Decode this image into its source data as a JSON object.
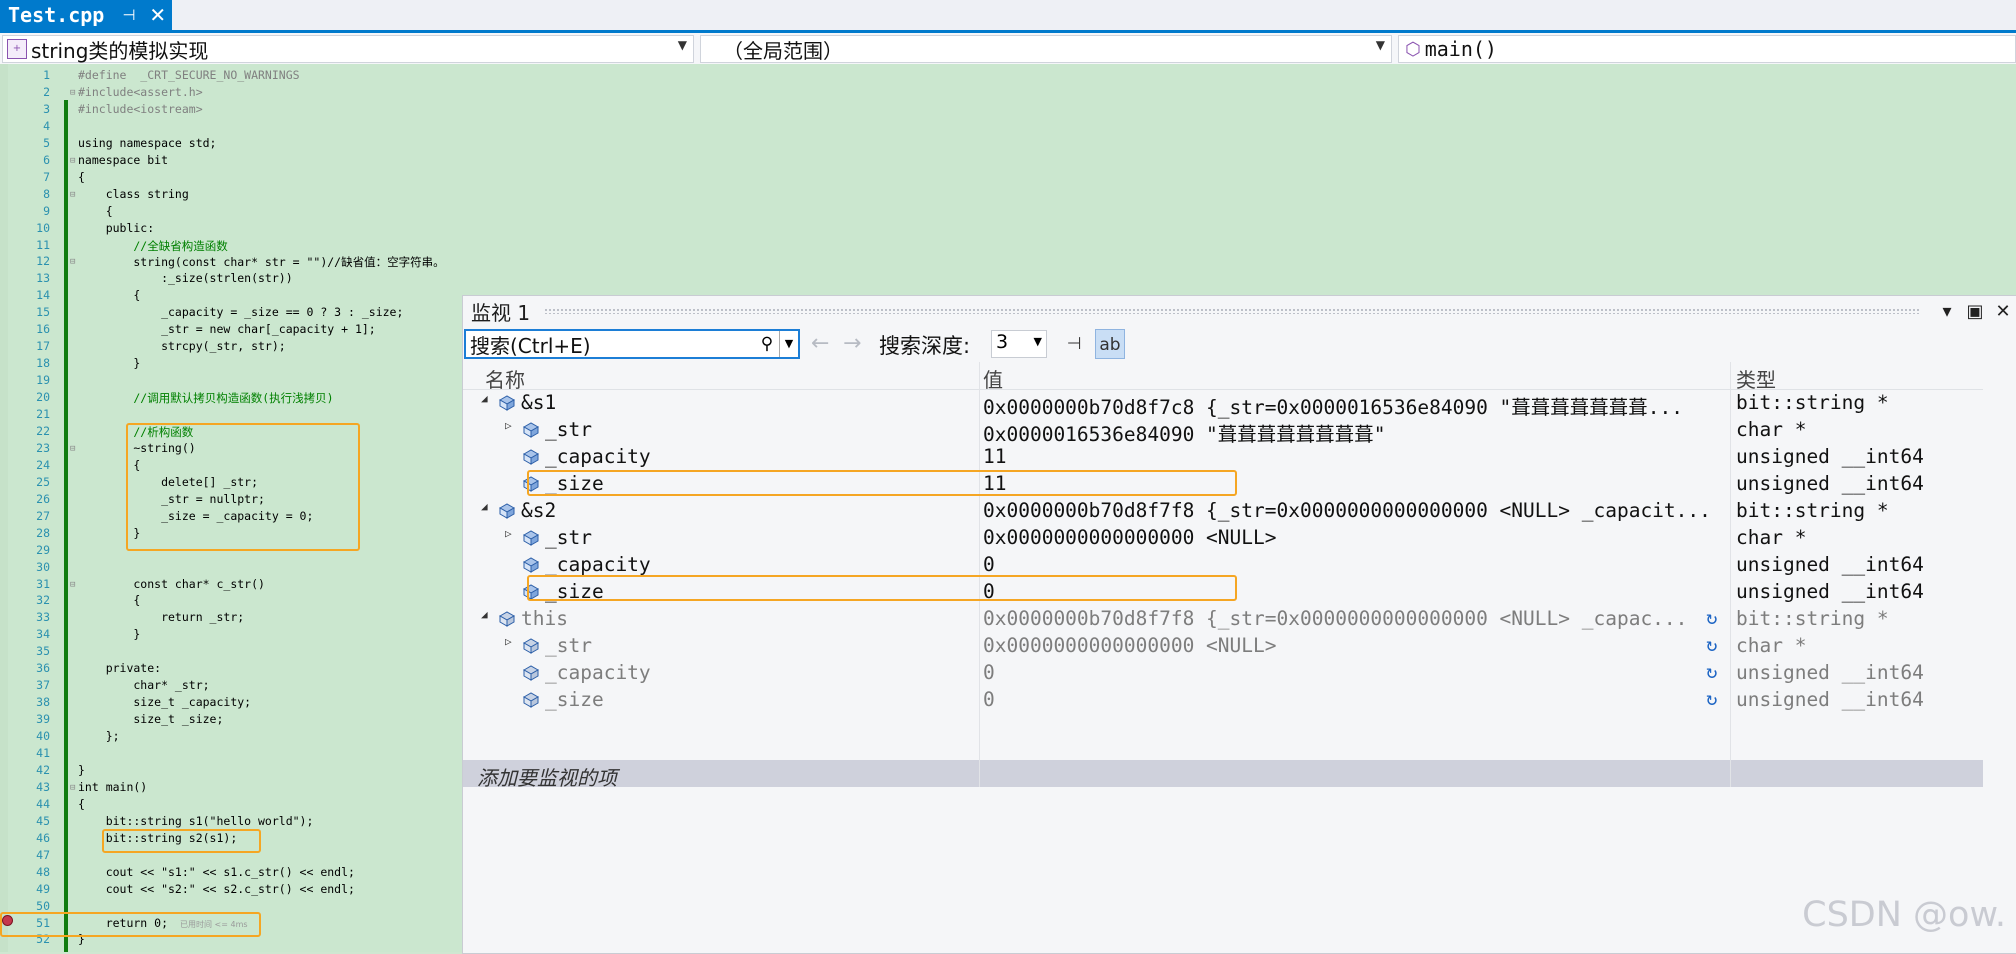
{
  "tab": {
    "title": "Test.cpp",
    "pin": "⊣",
    "close": "✕"
  },
  "nav": {
    "scope1": "string类的模拟实现",
    "scope2": "（全局范围）",
    "scope3": "main()"
  },
  "code": [
    {
      "n": "1",
      "t": "#define  _CRT_SECURE_NO_WARNINGS",
      "c": "pp"
    },
    {
      "n": "2",
      "t": "#include<assert.h>",
      "c": "pp"
    },
    {
      "n": "3",
      "t": "#include<iostream>",
      "c": "pp"
    },
    {
      "n": "4",
      "t": "",
      "c": ""
    },
    {
      "n": "5",
      "t": "using namespace std;",
      "c": ""
    },
    {
      "n": "6",
      "t": "namespace bit",
      "c": ""
    },
    {
      "n": "7",
      "t": "{",
      "c": ""
    },
    {
      "n": "8",
      "t": "    class string",
      "c": ""
    },
    {
      "n": "9",
      "t": "    {",
      "c": ""
    },
    {
      "n": "10",
      "t": "    public:",
      "c": ""
    },
    {
      "n": "11",
      "t": "        //全缺省构造函数",
      "c": "cm"
    },
    {
      "n": "12",
      "t": "        string(const char* str = \"\")//缺省值：空字符串。",
      "c": ""
    },
    {
      "n": "13",
      "t": "            :_size(strlen(str))",
      "c": ""
    },
    {
      "n": "14",
      "t": "        {",
      "c": ""
    },
    {
      "n": "15",
      "t": "            _capacity = _size == 0 ? 3 : _size;",
      "c": ""
    },
    {
      "n": "16",
      "t": "            _str = new char[_capacity + 1];",
      "c": ""
    },
    {
      "n": "17",
      "t": "            strcpy(_str, str);",
      "c": ""
    },
    {
      "n": "18",
      "t": "        }",
      "c": ""
    },
    {
      "n": "19",
      "t": "",
      "c": ""
    },
    {
      "n": "20",
      "t": "        //调用默认拷贝构造函数(执行浅拷贝)",
      "c": "cm"
    },
    {
      "n": "21",
      "t": "",
      "c": ""
    },
    {
      "n": "22",
      "t": "        //析构函数",
      "c": "cm"
    },
    {
      "n": "23",
      "t": "        ~string()",
      "c": ""
    },
    {
      "n": "24",
      "t": "        {",
      "c": ""
    },
    {
      "n": "25",
      "t": "            delete[] _str;",
      "c": ""
    },
    {
      "n": "26",
      "t": "            _str = nullptr;",
      "c": ""
    },
    {
      "n": "27",
      "t": "            _size = _capacity = 0;",
      "c": ""
    },
    {
      "n": "28",
      "t": "        }",
      "c": ""
    },
    {
      "n": "29",
      "t": "",
      "c": ""
    },
    {
      "n": "30",
      "t": "",
      "c": ""
    },
    {
      "n": "31",
      "t": "        const char* c_str()",
      "c": ""
    },
    {
      "n": "32",
      "t": "        {",
      "c": ""
    },
    {
      "n": "33",
      "t": "            return _str;",
      "c": ""
    },
    {
      "n": "34",
      "t": "        }",
      "c": ""
    },
    {
      "n": "35",
      "t": "",
      "c": ""
    },
    {
      "n": "36",
      "t": "    private:",
      "c": ""
    },
    {
      "n": "37",
      "t": "        char* _str;",
      "c": ""
    },
    {
      "n": "38",
      "t": "        size_t _capacity;",
      "c": ""
    },
    {
      "n": "39",
      "t": "        size_t _size;",
      "c": ""
    },
    {
      "n": "40",
      "t": "    };",
      "c": ""
    },
    {
      "n": "41",
      "t": "",
      "c": ""
    },
    {
      "n": "42",
      "t": "}",
      "c": ""
    },
    {
      "n": "43",
      "t": "int main()",
      "c": ""
    },
    {
      "n": "44",
      "t": "{",
      "c": ""
    },
    {
      "n": "45",
      "t": "    bit::string s1(\"hello world\");",
      "c": ""
    },
    {
      "n": "46",
      "t": "    bit::string s2(s1);",
      "c": ""
    },
    {
      "n": "47",
      "t": "",
      "c": ""
    },
    {
      "n": "48",
      "t": "    cout << \"s1:\" << s1.c_str() << endl;",
      "c": ""
    },
    {
      "n": "49",
      "t": "    cout << \"s2:\" << s2.c_str() << endl;",
      "c": ""
    },
    {
      "n": "50",
      "t": "",
      "c": ""
    },
    {
      "n": "51",
      "t": "    return 0;",
      "c": ""
    },
    {
      "n": "52",
      "t": "}",
      "c": ""
    }
  ],
  "elapsed_hint": "已用时间 <= 4ms",
  "watch": {
    "title": "监视 1",
    "search_placeholder": "搜索(Ctrl+E)",
    "depth_label": "搜索深度:",
    "depth_value": "3",
    "columns": {
      "name": "名称",
      "value": "值",
      "type": "类型"
    },
    "rows": [
      {
        "name": "&s1",
        "value": "0x0000000b70d8f7c8 {_str=0x0000016536e84090 \"葺葺葺葺葺葺葺...",
        "type": "bit::string *",
        "level": 0,
        "expand": "◢",
        "dim": false
      },
      {
        "name": "_str",
        "value": "0x0000016536e84090 \"葺葺葺葺葺葺葺葺\"",
        "type": "char *",
        "level": 1,
        "expand": "▷",
        "dim": false
      },
      {
        "name": "_capacity",
        "value": "11",
        "type": "unsigned __int64",
        "level": 1,
        "expand": "",
        "dim": false
      },
      {
        "name": "_size",
        "value": "11",
        "type": "unsigned __int64",
        "level": 1,
        "expand": "",
        "dim": false
      },
      {
        "name": "&s2",
        "value": "0x0000000b70d8f7f8 {_str=0x0000000000000000 <NULL> _capacit...",
        "type": "bit::string *",
        "level": 0,
        "expand": "◢",
        "dim": false
      },
      {
        "name": "_str",
        "value": "0x0000000000000000 <NULL>",
        "type": "char *",
        "level": 1,
        "expand": "▷",
        "dim": false
      },
      {
        "name": "_capacity",
        "value": "0",
        "type": "unsigned __int64",
        "level": 1,
        "expand": "",
        "dim": false
      },
      {
        "name": "_size",
        "value": "0",
        "type": "unsigned __int64",
        "level": 1,
        "expand": "",
        "dim": false
      },
      {
        "name": "this",
        "value": "0x0000000b70d8f7f8 {_str=0x0000000000000000 <NULL> _capac...",
        "type": "bit::string *",
        "level": 0,
        "expand": "◢",
        "dim": true
      },
      {
        "name": "_str",
        "value": "0x0000000000000000 <NULL>",
        "type": "char *",
        "level": 1,
        "expand": "▷",
        "dim": true
      },
      {
        "name": "_capacity",
        "value": "0",
        "type": "unsigned __int64",
        "level": 1,
        "expand": "",
        "dim": true
      },
      {
        "name": "_size",
        "value": "0",
        "type": "unsigned __int64",
        "level": 1,
        "expand": "",
        "dim": true
      }
    ],
    "add_item": "添加要监视的项"
  },
  "watermark": "CSDN @ow.",
  "colors": {
    "accent": "#007acc",
    "highlight": "#f5a623",
    "editor_bg": "#cbe7cf",
    "breakpoint": "#c4384d"
  }
}
